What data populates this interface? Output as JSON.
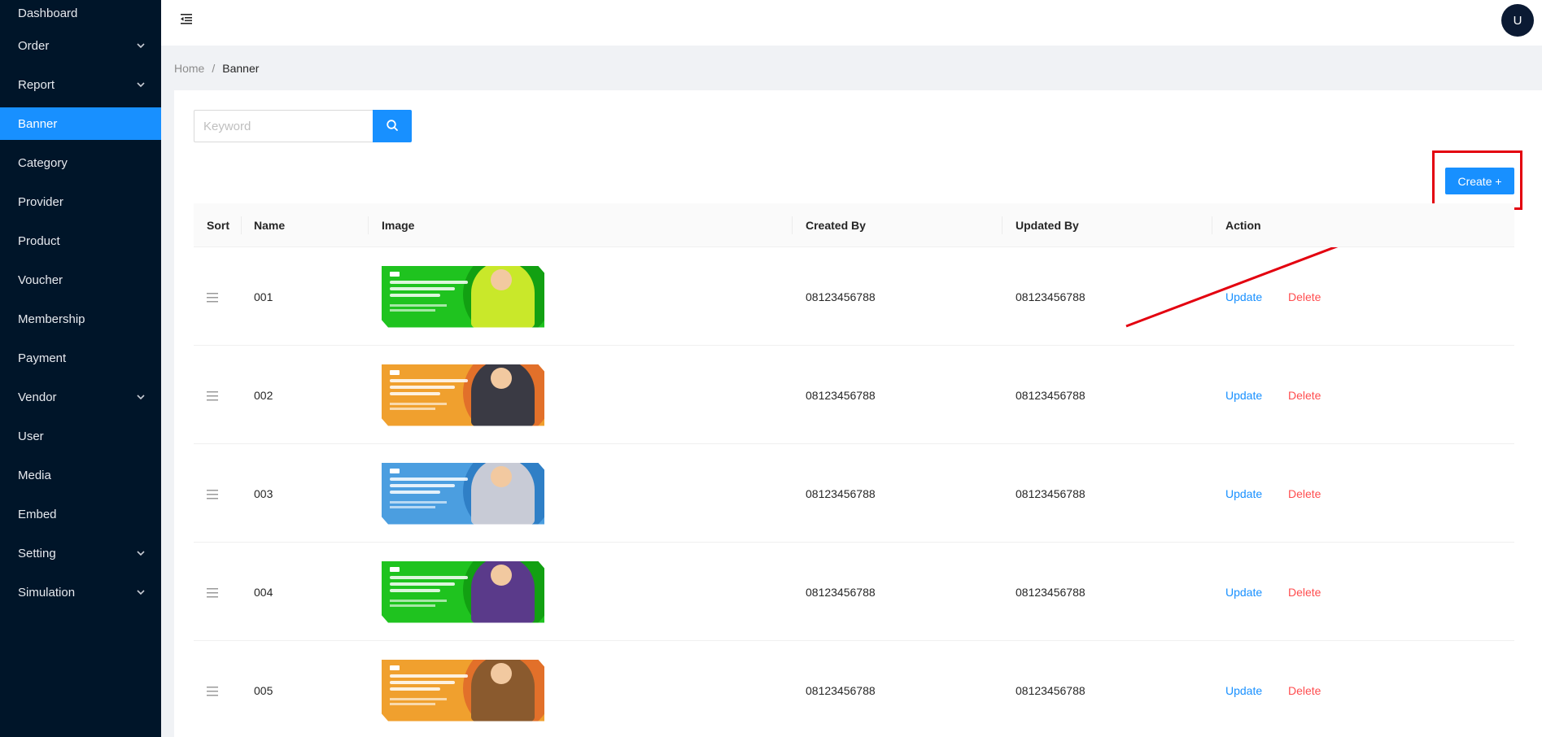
{
  "sidebar": {
    "items": [
      {
        "label": "Dashboard",
        "chevron": false
      },
      {
        "label": "Order",
        "chevron": true
      },
      {
        "label": "Report",
        "chevron": true
      },
      {
        "label": "Banner",
        "chevron": false,
        "active": true
      },
      {
        "label": "Category",
        "chevron": false
      },
      {
        "label": "Provider",
        "chevron": false
      },
      {
        "label": "Product",
        "chevron": false
      },
      {
        "label": "Voucher",
        "chevron": false
      },
      {
        "label": "Membership",
        "chevron": false
      },
      {
        "label": "Payment",
        "chevron": false
      },
      {
        "label": "Vendor",
        "chevron": true
      },
      {
        "label": "User",
        "chevron": false
      },
      {
        "label": "Media",
        "chevron": false
      },
      {
        "label": "Embed",
        "chevron": false
      },
      {
        "label": "Setting",
        "chevron": true
      },
      {
        "label": "Simulation",
        "chevron": true
      }
    ]
  },
  "header": {
    "menu_icon": "menu-fold-icon",
    "avatar_letter": "U"
  },
  "breadcrumb": {
    "home": "Home",
    "separator": "/",
    "current": "Banner"
  },
  "search": {
    "placeholder": "Keyword",
    "value": "",
    "icon": "search-icon"
  },
  "toolbar": {
    "create_label": "Create +"
  },
  "table": {
    "columns": [
      "Sort",
      "Name",
      "Image",
      "Created By",
      "Updated By",
      "Action"
    ],
    "rows": [
      {
        "name": "001",
        "created_by": "08123456788",
        "updated_by": "08123456788",
        "update_label": "Update",
        "delete_label": "Delete",
        "banner_bg": "#1fc31f",
        "banner_accent": "#12a012",
        "figure_color": "#c9e82a"
      },
      {
        "name": "002",
        "created_by": "08123456788",
        "updated_by": "08123456788",
        "update_label": "Update",
        "delete_label": "Delete",
        "banner_bg": "#f0a02e",
        "banner_accent": "#e2702a",
        "figure_color": "#3a3a44"
      },
      {
        "name": "003",
        "created_by": "08123456788",
        "updated_by": "08123456788",
        "update_label": "Update",
        "delete_label": "Delete",
        "banner_bg": "#4b9ee0",
        "banner_accent": "#2f7fc6",
        "figure_color": "#c8cbd6"
      },
      {
        "name": "004",
        "created_by": "08123456788",
        "updated_by": "08123456788",
        "update_label": "Update",
        "delete_label": "Delete",
        "banner_bg": "#1fc31f",
        "banner_accent": "#12a012",
        "figure_color": "#5a3a8a"
      },
      {
        "name": "005",
        "created_by": "08123456788",
        "updated_by": "08123456788",
        "update_label": "Update",
        "delete_label": "Delete",
        "banner_bg": "#f0a02e",
        "banner_accent": "#e2702a",
        "figure_color": "#8a5a2e"
      }
    ]
  },
  "colors": {
    "primary": "#1890ff",
    "sidebar_bg": "#001529",
    "danger": "#ff4d4f",
    "annotation": "#e3000f"
  }
}
